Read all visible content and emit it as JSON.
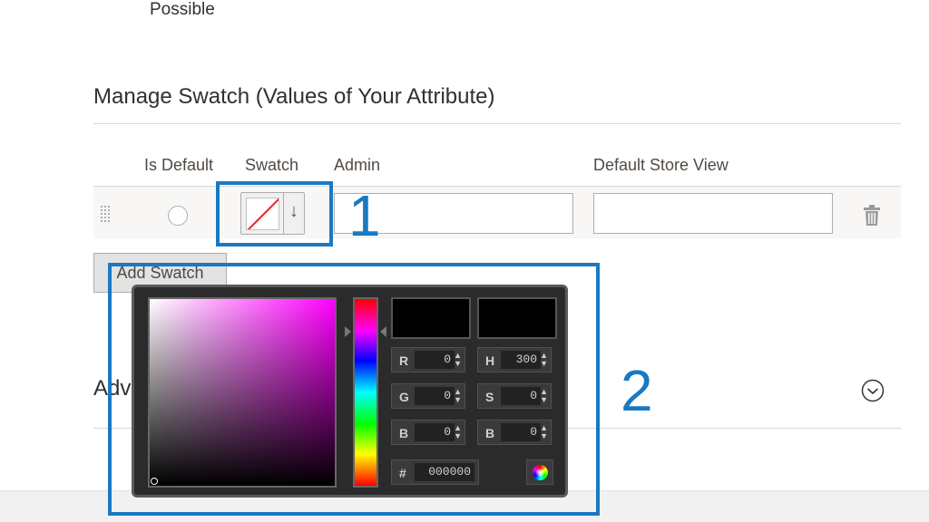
{
  "possible_label": "Possible",
  "section_title": "Manage Swatch (Values of Your Attribute)",
  "columns": {
    "is_default": "Is Default",
    "swatch": "Swatch",
    "admin": "Admin",
    "default_store_view": "Default Store View"
  },
  "row": {
    "admin_value": "",
    "store_view_value": ""
  },
  "add_swatch_label": "Add Swatch",
  "advanced_title": "Adva",
  "callouts": [
    "1",
    "2"
  ],
  "color_picker": {
    "fields": {
      "r": {
        "label": "R",
        "value": "0"
      },
      "g": {
        "label": "G",
        "value": "0"
      },
      "b": {
        "label": "B",
        "value": "0"
      },
      "h": {
        "label": "H",
        "value": "300"
      },
      "s": {
        "label": "S",
        "value": "0"
      },
      "br": {
        "label": "B",
        "value": "0"
      }
    },
    "hex_label": "#",
    "hex_value": "000000",
    "hue_color": "#ff00ff",
    "current_color": "#000000"
  },
  "colors": {
    "accent": "#1979c3",
    "no_color_line": "#e22626"
  },
  "icons": {
    "drag": "drag-handle-icon",
    "arrow": "arrow-down-icon",
    "trash": "trash-icon",
    "toggle": "chevron-down-circle-icon",
    "wheel": "color-wheel-icon"
  }
}
